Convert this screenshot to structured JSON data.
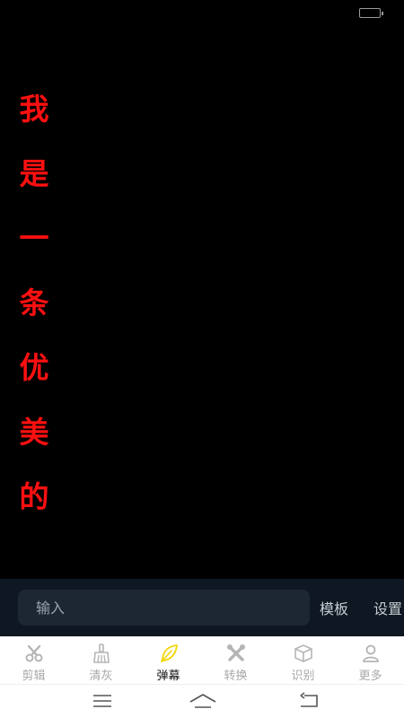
{
  "danmu": {
    "chars": [
      "我",
      "是",
      "一",
      "条",
      "优",
      "美",
      "的"
    ],
    "color": "#ff1010"
  },
  "input_bar": {
    "placeholder": "输入",
    "template_label": "模板",
    "settings_label": "设置"
  },
  "tabs": [
    {
      "label": "剪辑",
      "icon": "scissors-icon",
      "active": false
    },
    {
      "label": "清灰",
      "icon": "broom-icon",
      "active": false
    },
    {
      "label": "弹幕",
      "icon": "feather-icon",
      "active": true
    },
    {
      "label": "转换",
      "icon": "tools-icon",
      "active": false
    },
    {
      "label": "识别",
      "icon": "box-icon",
      "active": false
    },
    {
      "label": "更多",
      "icon": "person-icon",
      "active": false
    }
  ],
  "colors": {
    "accent": "#f2d600",
    "background": "#000000",
    "input_bar": "#0e1722"
  }
}
